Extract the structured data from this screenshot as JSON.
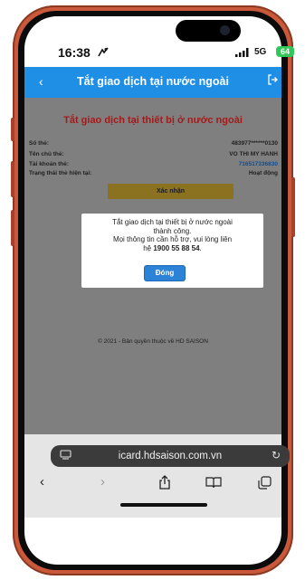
{
  "status_bar": {
    "time": "16:38",
    "focus_icon": "focus-mode-icon",
    "signal_icon": "cellular-signal-icon",
    "network": "5G",
    "battery": "64"
  },
  "header": {
    "title": "Tắt giao dịch tại nước ngoài",
    "back_icon": "chevron-left-icon",
    "logout_icon": "logout-icon",
    "color": "#1f8fe5"
  },
  "card": {
    "title": "Tắt giao dịch tại thiết bị ở nước ngoài",
    "rows": [
      {
        "label": "Số thẻ:",
        "value": "483977******0130"
      },
      {
        "label": "Tên chủ thẻ:",
        "value": "VO THI MY HANH"
      },
      {
        "label": "Tài khoản thẻ:",
        "value": "716517336830"
      },
      {
        "label": "Trạng thái thẻ hiện tại:",
        "value": "Hoạt động"
      }
    ],
    "confirm_button": "Xác nhận"
  },
  "dialog": {
    "line1": "Tắt giao dịch tại thiết bị ở nước ngoài",
    "line2": "thành công.",
    "line3": "Mọi thông tin cần hỗ trợ, vui lòng liên",
    "line4_prefix": "hệ ",
    "hotline": "1900 55 88 54",
    "line4_suffix": ".",
    "close_button": "Đóng"
  },
  "footer": {
    "copyright": "© 2021 - Bản quyền thuộc về HD SAISON"
  },
  "browser": {
    "url": "icard.hdsaison.com.vn",
    "page_icon": "page-settings-icon",
    "reload_icon": "reload-icon",
    "toolbar": {
      "back_icon": "back-arrow-icon",
      "forward_icon": "forward-arrow-icon",
      "share_icon": "share-icon",
      "bookmarks_icon": "bookmarks-icon",
      "tabs_icon": "tabs-icon"
    }
  }
}
